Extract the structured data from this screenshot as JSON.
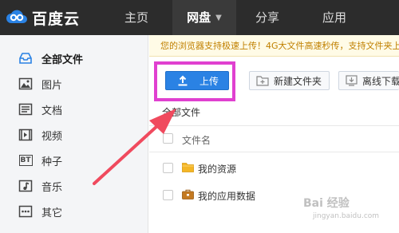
{
  "app": {
    "logo_text": "百度云"
  },
  "nav": {
    "items": [
      {
        "label": "主页"
      },
      {
        "label": "网盘",
        "active": true
      },
      {
        "label": "分享"
      },
      {
        "label": "应用"
      }
    ],
    "dropdown_icon": "chevron-down-icon"
  },
  "sidebar": {
    "items": [
      {
        "label": "全部文件",
        "icon": "all-files-icon",
        "active": true
      },
      {
        "label": "图片",
        "icon": "image-icon"
      },
      {
        "label": "文档",
        "icon": "document-icon"
      },
      {
        "label": "视频",
        "icon": "video-icon"
      },
      {
        "label": "种子",
        "icon": "bt-icon",
        "icon_text": "BT"
      },
      {
        "label": "音乐",
        "icon": "music-icon"
      },
      {
        "label": "其它",
        "icon": "more-icon"
      }
    ]
  },
  "notice": {
    "text": "您的浏览器支持极速上传！4G大文件高速秒传，支持文件夹上传！"
  },
  "toolbar": {
    "upload_label": "上传",
    "new_folder_label": "新建文件夹",
    "offline_download_label": "离线下载"
  },
  "breadcrumb": {
    "text": "全部文件"
  },
  "file_list": {
    "header_name": "文件名",
    "rows": [
      {
        "name": "我的资源",
        "icon": "folder-icon"
      },
      {
        "name": "我的应用数据",
        "icon": "app-folder-icon"
      }
    ]
  },
  "watermark": {
    "text": "Bai 经验",
    "sub": "jingyan.baidu.com"
  },
  "colors": {
    "accent": "#2a82e4",
    "highlight": "#e040d0",
    "arrow": "#f04a5e",
    "topbar": "#2c2c2c"
  }
}
